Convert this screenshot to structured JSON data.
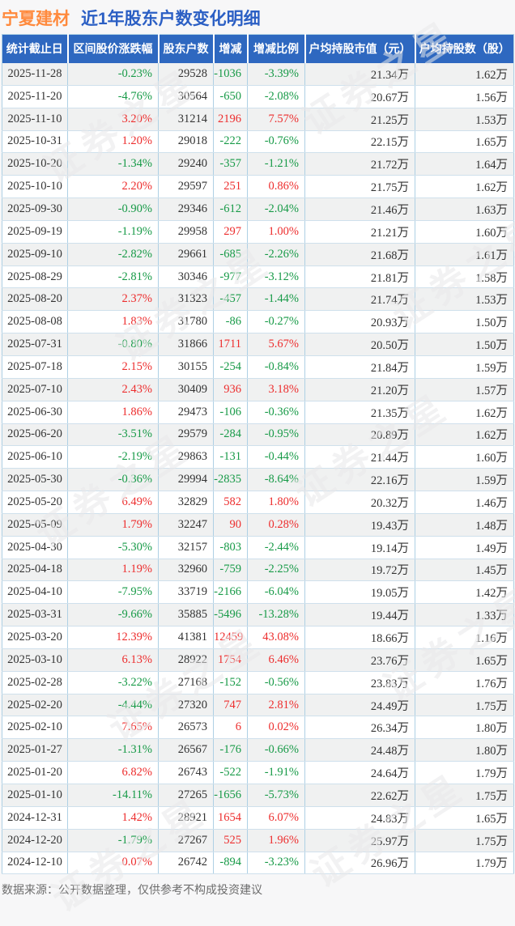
{
  "title": {
    "stock": "宁夏建材",
    "subtitle": "近1年股东户数变化明细"
  },
  "watermark": {
    "text": "证券之星"
  },
  "colors": {
    "up_red": "#ed2d2d",
    "down_green": "#179a47",
    "header_bg": "#2e68c0",
    "title_blue": "#2b5fc4",
    "stock_orange": "#ff8a3d"
  },
  "table": {
    "headers": [
      "统计截止日",
      "区间股价涨跌幅",
      "股东户数",
      "增减",
      "增减比例",
      "户均持股市值（元）",
      "户均持股数（股）"
    ],
    "header_names": [
      "date",
      "price-change",
      "holder-count",
      "change",
      "change-ratio",
      "avg-market-value",
      "avg-shares"
    ],
    "rows": [
      [
        "2025-11-28",
        "-0.23%",
        "29528",
        "-1036",
        "-3.39%",
        "21.34万",
        "1.62万"
      ],
      [
        "2025-11-20",
        "-4.76%",
        "30564",
        "-650",
        "-2.08%",
        "20.67万",
        "1.56万"
      ],
      [
        "2025-11-10",
        "3.20%",
        "31214",
        "2196",
        "7.57%",
        "21.25万",
        "1.53万"
      ],
      [
        "2025-10-31",
        "1.20%",
        "29018",
        "-222",
        "-0.76%",
        "22.15万",
        "1.65万"
      ],
      [
        "2025-10-20",
        "-1.34%",
        "29240",
        "-357",
        "-1.21%",
        "21.72万",
        "1.64万"
      ],
      [
        "2025-10-10",
        "2.20%",
        "29597",
        "251",
        "0.86%",
        "21.75万",
        "1.62万"
      ],
      [
        "2025-09-30",
        "-0.90%",
        "29346",
        "-612",
        "-2.04%",
        "21.46万",
        "1.63万"
      ],
      [
        "2025-09-19",
        "-1.19%",
        "29958",
        "297",
        "1.00%",
        "21.21万",
        "1.60万"
      ],
      [
        "2025-09-10",
        "-2.82%",
        "29661",
        "-685",
        "-2.26%",
        "21.68万",
        "1.61万"
      ],
      [
        "2025-08-29",
        "-2.81%",
        "30346",
        "-977",
        "-3.12%",
        "21.81万",
        "1.58万"
      ],
      [
        "2025-08-20",
        "2.37%",
        "31323",
        "-457",
        "-1.44%",
        "21.74万",
        "1.53万"
      ],
      [
        "2025-08-08",
        "1.83%",
        "31780",
        "-86",
        "-0.27%",
        "20.93万",
        "1.50万"
      ],
      [
        "2025-07-31",
        "-0.80%",
        "31866",
        "1711",
        "5.67%",
        "20.50万",
        "1.50万"
      ],
      [
        "2025-07-18",
        "2.15%",
        "30155",
        "-254",
        "-0.84%",
        "21.84万",
        "1.59万"
      ],
      [
        "2025-07-10",
        "2.43%",
        "30409",
        "936",
        "3.18%",
        "21.20万",
        "1.57万"
      ],
      [
        "2025-06-30",
        "1.86%",
        "29473",
        "-106",
        "-0.36%",
        "21.35万",
        "1.62万"
      ],
      [
        "2025-06-20",
        "-3.51%",
        "29579",
        "-284",
        "-0.95%",
        "20.89万",
        "1.62万"
      ],
      [
        "2025-06-10",
        "-2.19%",
        "29863",
        "-131",
        "-0.44%",
        "21.44万",
        "1.60万"
      ],
      [
        "2025-05-30",
        "-0.36%",
        "29994",
        "-2835",
        "-8.64%",
        "22.16万",
        "1.59万"
      ],
      [
        "2025-05-20",
        "6.49%",
        "32829",
        "582",
        "1.80%",
        "20.32万",
        "1.46万"
      ],
      [
        "2025-05-09",
        "1.79%",
        "32247",
        "90",
        "0.28%",
        "19.43万",
        "1.48万"
      ],
      [
        "2025-04-30",
        "-5.30%",
        "32157",
        "-803",
        "-2.44%",
        "19.14万",
        "1.49万"
      ],
      [
        "2025-04-18",
        "1.19%",
        "32960",
        "-759",
        "-2.25%",
        "19.72万",
        "1.45万"
      ],
      [
        "2025-04-10",
        "-7.95%",
        "33719",
        "-2166",
        "-6.04%",
        "19.05万",
        "1.42万"
      ],
      [
        "2025-03-31",
        "-9.66%",
        "35885",
        "-5496",
        "-13.28%",
        "19.44万",
        "1.33万"
      ],
      [
        "2025-03-20",
        "12.39%",
        "41381",
        "12459",
        "43.08%",
        "18.66万",
        "1.16万"
      ],
      [
        "2025-03-10",
        "6.13%",
        "28922",
        "1754",
        "6.46%",
        "23.76万",
        "1.65万"
      ],
      [
        "2025-02-28",
        "-3.22%",
        "27168",
        "-152",
        "-0.56%",
        "23.83万",
        "1.76万"
      ],
      [
        "2025-02-20",
        "-4.44%",
        "27320",
        "747",
        "2.81%",
        "24.49万",
        "1.75万"
      ],
      [
        "2025-02-10",
        "7.65%",
        "26573",
        "6",
        "0.02%",
        "26.34万",
        "1.80万"
      ],
      [
        "2025-01-27",
        "-1.31%",
        "26567",
        "-176",
        "-0.66%",
        "24.48万",
        "1.80万"
      ],
      [
        "2025-01-20",
        "6.82%",
        "26743",
        "-522",
        "-1.91%",
        "24.64万",
        "1.79万"
      ],
      [
        "2025-01-10",
        "-14.11%",
        "27265",
        "-1656",
        "-5.73%",
        "22.62万",
        "1.75万"
      ],
      [
        "2024-12-31",
        "1.42%",
        "28921",
        "1654",
        "6.07%",
        "24.83万",
        "1.65万"
      ],
      [
        "2024-12-20",
        "-1.79%",
        "27267",
        "525",
        "1.96%",
        "25.97万",
        "1.75万"
      ],
      [
        "2024-12-10",
        "0.07%",
        "26742",
        "-894",
        "-3.23%",
        "26.96万",
        "1.79万"
      ]
    ]
  },
  "footer": {
    "note": "数据来源：公开数据整理，仅供参考不构成投资建议"
  }
}
